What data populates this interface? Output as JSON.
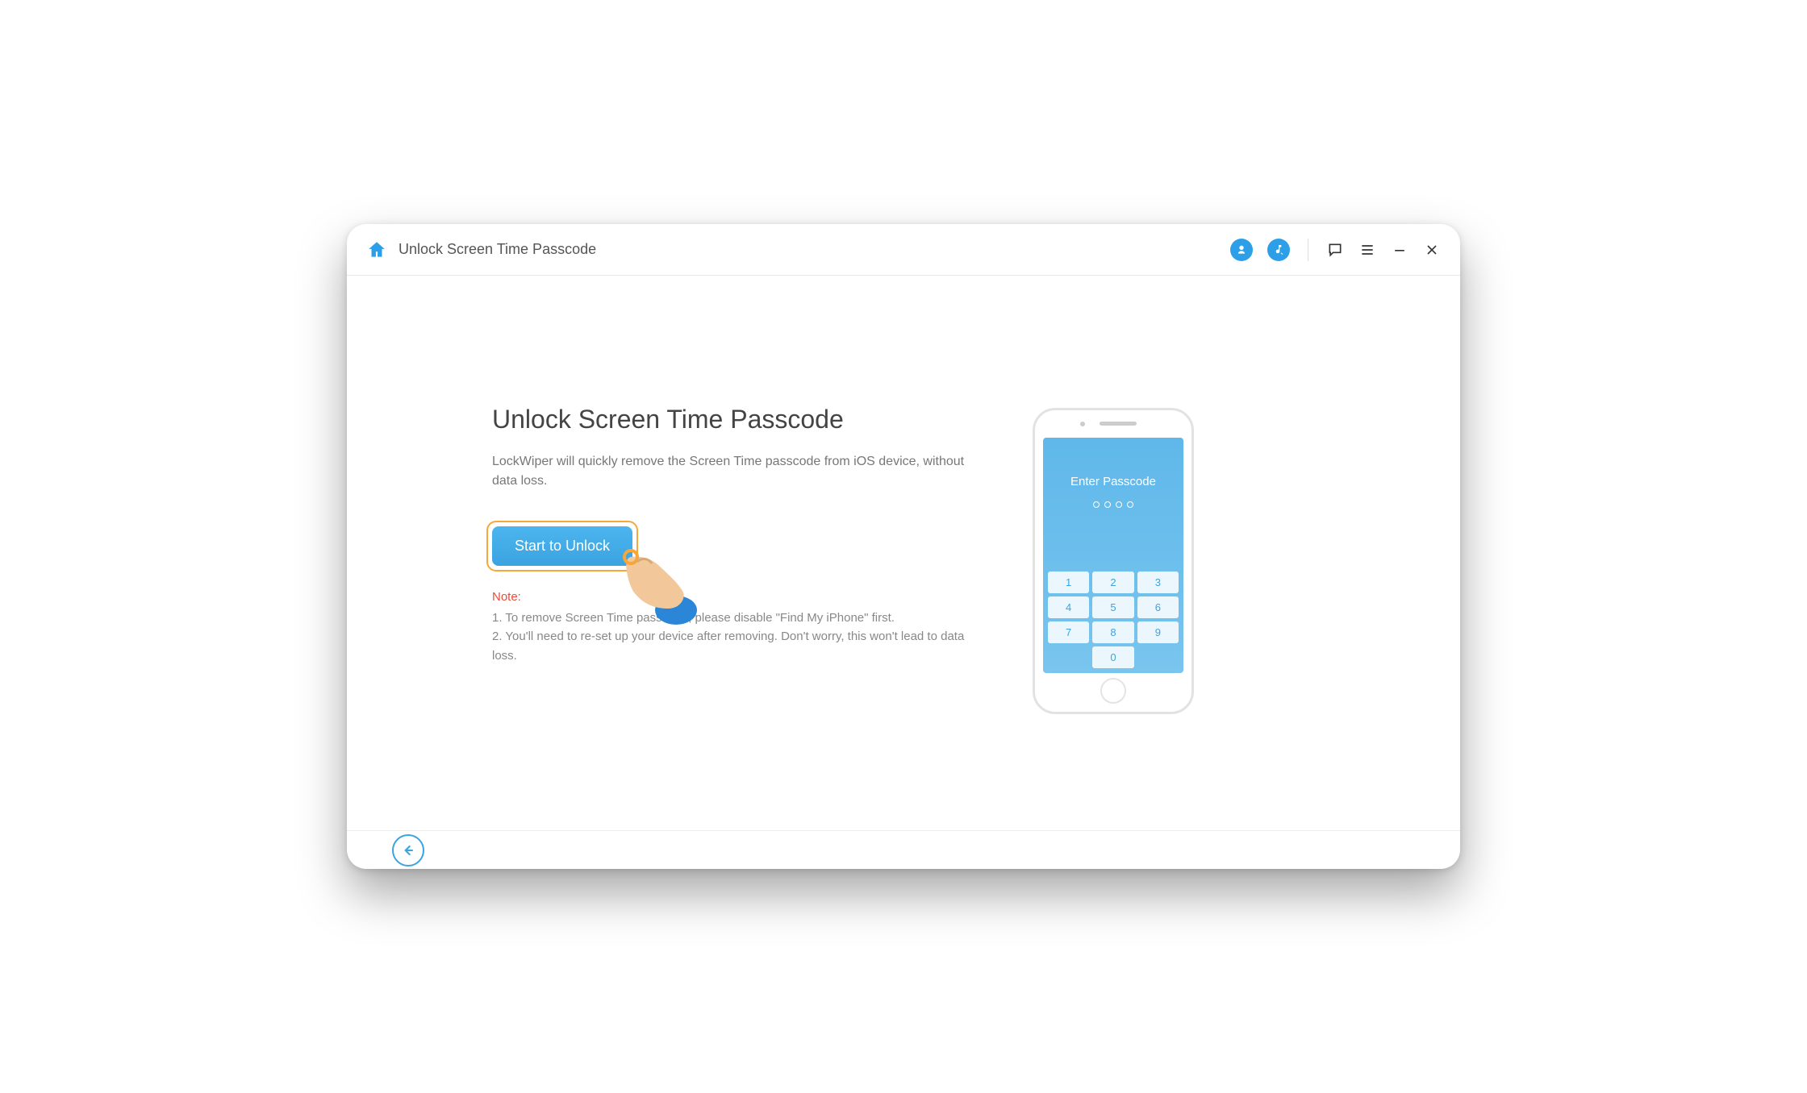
{
  "header": {
    "title": "Unlock Screen Time Passcode"
  },
  "main": {
    "heading": "Unlock Screen Time Passcode",
    "description": "LockWiper will quickly remove the Screen Time passcode from iOS device, without data loss.",
    "start_button": "Start to Unlock",
    "note_label": "Note:",
    "note_1": "1. To remove Screen Time passcode, please disable \"Find My iPhone\" first.",
    "note_2": "2. You'll need to re-set up your device after removing. Don't worry, this won't lead to data loss."
  },
  "phone": {
    "enter_passcode": "Enter Passcode",
    "keys": [
      "1",
      "2",
      "3",
      "4",
      "5",
      "6",
      "7",
      "8",
      "9",
      "0"
    ]
  },
  "colors": {
    "accent": "#3ba4e0",
    "highlight_ring": "#f7a63a",
    "warning": "#e74c3c"
  }
}
